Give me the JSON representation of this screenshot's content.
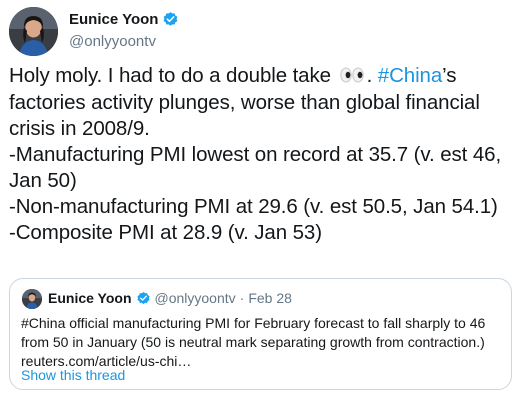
{
  "author": {
    "name": "Eunice Yoon",
    "handle": "@onlyyoontv"
  },
  "tweet": {
    "line1_before": "Holy moly. I had to do a double take",
    "emoji": "eyes",
    "line1_sep": ". ",
    "hashtag": "#China",
    "line1_after": "’s",
    "line2": "factories activity plunges, worse than global financial",
    "line3": "crisis in 2008/9.",
    "line4": "-Manufacturing PMI lowest on record at 35.7 (v. est 46,",
    "line5": "Jan 50)",
    "line6": "-Non-manufacturing PMI at 29.6 (v. est 50.5, Jan 54.1)",
    "line7": "-Composite PMI at 28.9 (v. Jan 53)"
  },
  "quote": {
    "name": "Eunice Yoon",
    "handle": "@onlyyoontv",
    "separator": "·",
    "date": "Feb 28",
    "line1": "#China official manufacturing PMI for February forecast to fall sharply to 46",
    "line2": "from 50 in January (50 is neutral mark separating growth from contraction.)",
    "link": "reuters.com/article/us-chi…",
    "show_thread": "Show this thread"
  },
  "colors": {
    "link_blue": "#1b95e0",
    "verified_blue": "#1da1f2",
    "secondary_text": "#657786",
    "border": "#ccd6dd"
  }
}
